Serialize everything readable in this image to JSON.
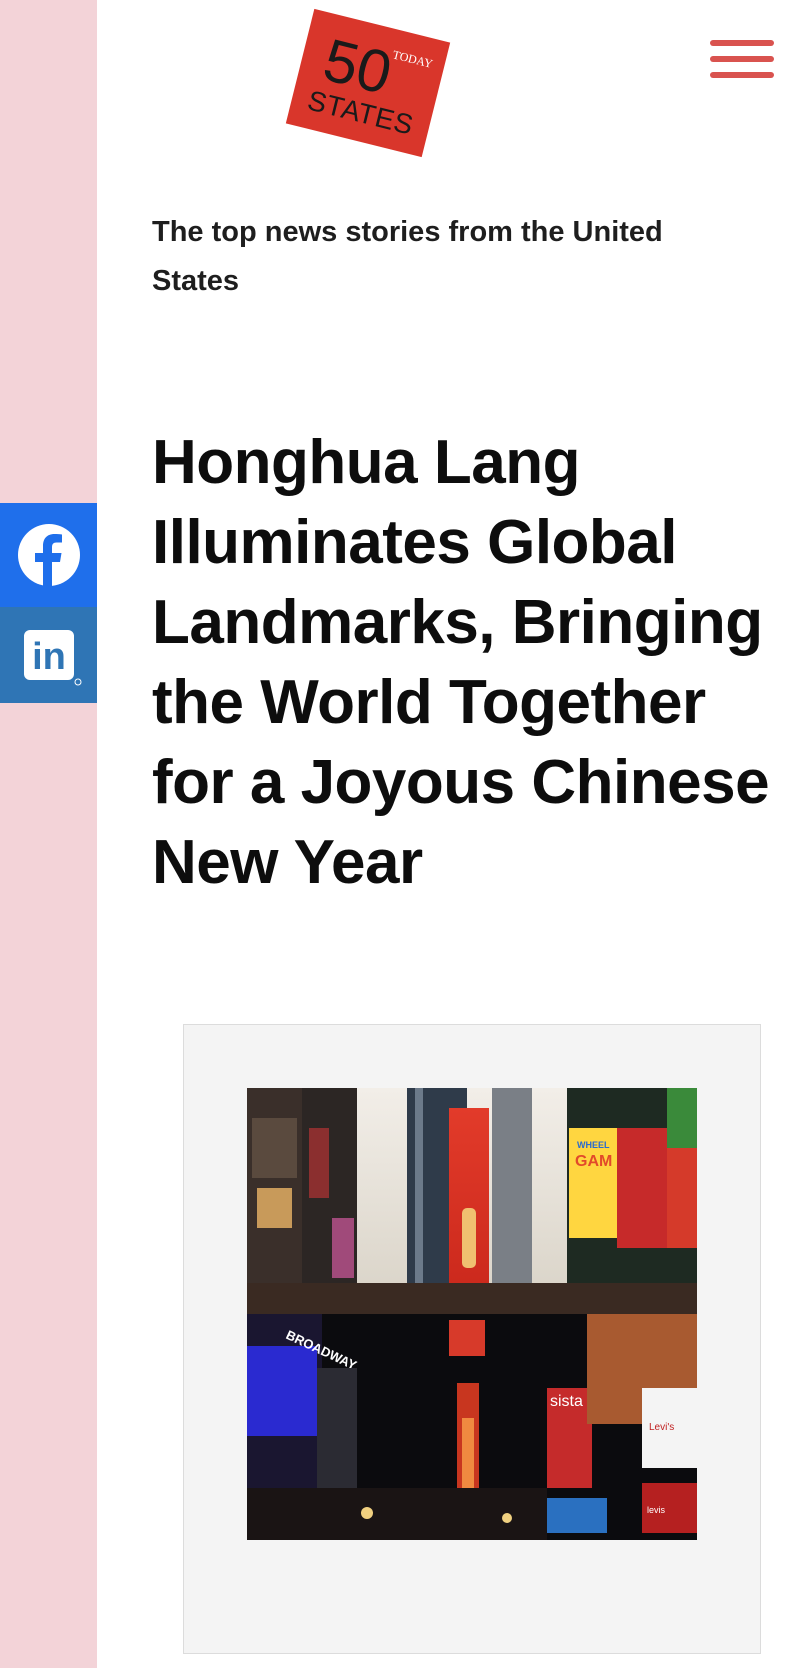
{
  "brand": {
    "logo_number": "50",
    "logo_word": "STATES",
    "logo_tag": "TODAY"
  },
  "tagline": "The top news stories from the United States",
  "article": {
    "headline": "Honghua Lang Illuminates Global Landmarks, Bringing the World Together for a Joyous Chinese New Year",
    "image_signs": {
      "sign_a": "WHEEL",
      "sign_b": "GAM",
      "sign_c": "sista",
      "sign_d": "Levi's",
      "sign_e": "levis",
      "sign_f": "BROADWAY"
    }
  },
  "share": {
    "facebook_icon": "facebook-icon",
    "linkedin_icon": "linkedin-icon",
    "linkedin_label": "in"
  },
  "colors": {
    "rail": "#f3d3d8",
    "facebook": "#1f6feb",
    "linkedin": "#2f75b5",
    "brand_red": "#d9362b",
    "menu": "#d9534f"
  }
}
